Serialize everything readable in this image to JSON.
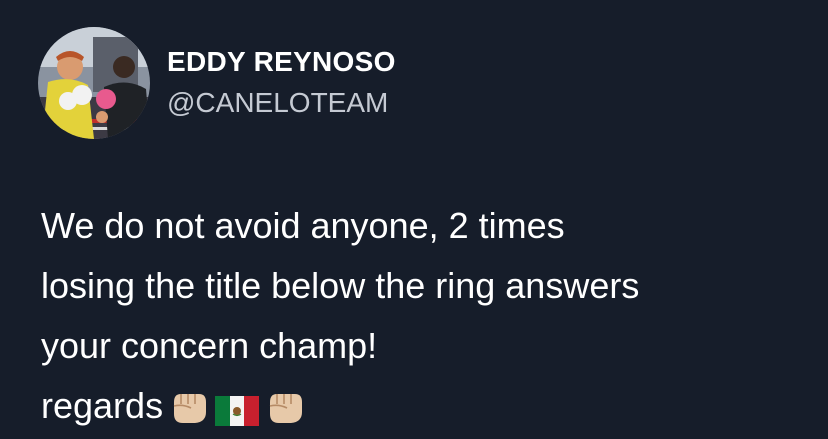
{
  "tweet": {
    "author": {
      "display_name": "EDDY REYNOSO",
      "handle": "@CANELOTEAM",
      "avatar_icon": "profile-photo-boxing"
    },
    "body": {
      "lines": [
        "We do not avoid anyone, 2 times",
        "losing the title below the ring answers",
        "your concern champ!",
        "regards"
      ],
      "trailing_emojis": [
        "fist-icon",
        "mexico-flag-icon",
        "fist-icon"
      ]
    }
  },
  "colors": {
    "background": "#161d2a",
    "text": "#ffffff",
    "handle": "#c5cad3"
  }
}
